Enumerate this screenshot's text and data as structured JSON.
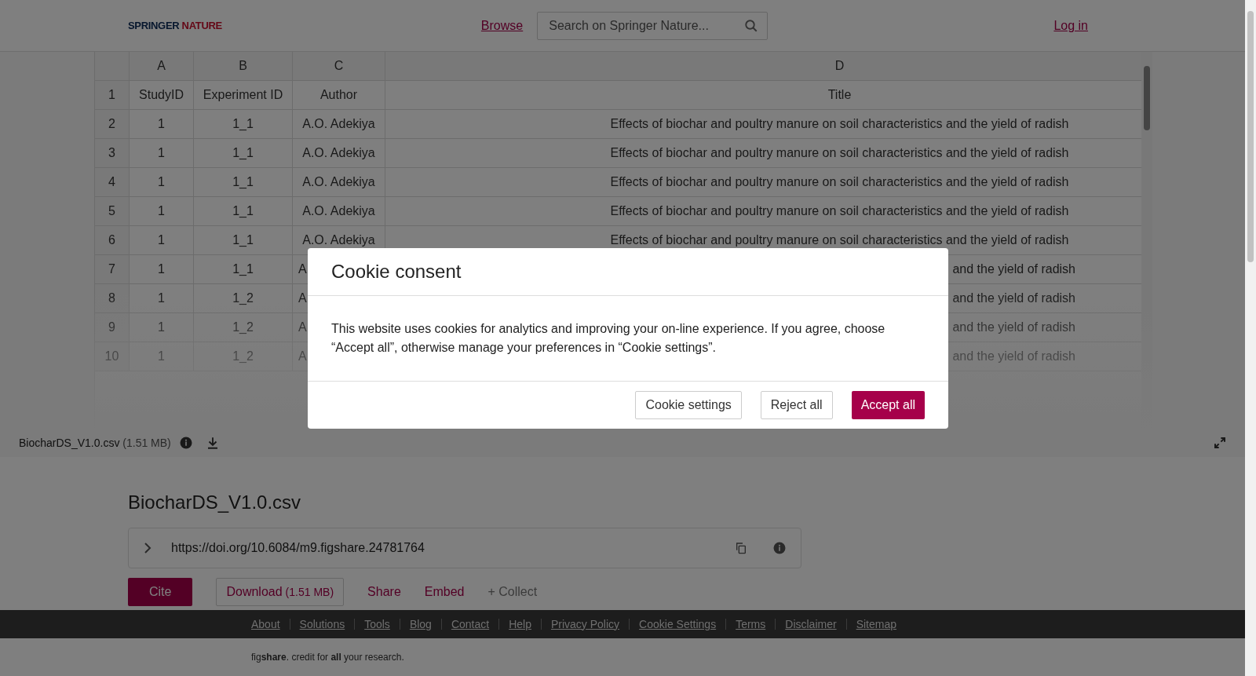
{
  "header": {
    "logo": [
      "SPRINGER",
      "NATURE"
    ],
    "browse": "Browse",
    "search": {
      "placeholder": "Search on Springer Nature..."
    },
    "login": "Log in"
  },
  "table": {
    "columns": [
      "A",
      "B",
      "C",
      "D"
    ],
    "rows": [
      {
        "number": "1",
        "cells": [
          "StudyID",
          "Experiment ID",
          "Author",
          "Title"
        ]
      },
      {
        "number": "2",
        "cells": [
          "1",
          "1_1",
          "A.O. Adekiya",
          "Effects of biochar and poultry manure on soil characteristics and the yield of radish"
        ]
      },
      {
        "number": "3",
        "cells": [
          "1",
          "1_1",
          "A.O. Adekiya",
          "Effects of biochar and poultry manure on soil characteristics and the yield of radish"
        ]
      },
      {
        "number": "4",
        "cells": [
          "1",
          "1_1",
          "A.O. Adekiya",
          "Effects of biochar and poultry manure on soil characteristics and the yield of radish"
        ]
      },
      {
        "number": "5",
        "cells": [
          "1",
          "1_1",
          "A.O. Adekiya",
          "Effects of biochar and poultry manure on soil characteristics and the yield of radish"
        ]
      },
      {
        "number": "6",
        "cells": [
          "1",
          "1_1",
          "A.O. Adekiya",
          "Effects of biochar and poultry manure on soil characteristics and the yield of radish"
        ]
      },
      {
        "number": "7",
        "covered": true,
        "cells": [
          "1",
          "1_1",
          "A",
          "and the yield of radish"
        ]
      },
      {
        "number": "8",
        "covered": true,
        "cells": [
          "1",
          "1_2",
          "A",
          "and the yield of radish"
        ]
      },
      {
        "number": "9",
        "covered": true,
        "cells": [
          "1",
          "1_2",
          "A",
          "and the yield of radish"
        ]
      },
      {
        "number": "10",
        "covered": true,
        "cells": [
          "1",
          "1_2",
          "A",
          "and the yield of radish"
        ]
      }
    ]
  },
  "file_bar": {
    "name": "BiocharDS_V1.0.csv",
    "size": "(1.51 MB)"
  },
  "item": {
    "title": "BiocharDS_V1.0.csv",
    "doi": "https://doi.org/10.6084/m9.figshare.24781764",
    "actions": [
      {
        "kind": "primary",
        "label": "Cite"
      },
      {
        "kind": "outline",
        "label": "Download",
        "size": "(1.51 MB)"
      },
      {
        "kind": "link",
        "label": "Share"
      },
      {
        "kind": "link",
        "label": "Embed"
      },
      {
        "kind": "muted",
        "label": "+ Collect"
      }
    ]
  },
  "footer": {
    "links": [
      "About",
      "Solutions",
      "Tools",
      "Blog",
      "Contact",
      "Help",
      "Privacy Policy",
      "Cookie Settings",
      "Terms",
      "Disclaimer",
      "Sitemap"
    ],
    "tagline": "fig**share**. credit for **all** your research."
  },
  "cookie_dialog": {
    "title": "Cookie consent",
    "text": "This website uses cookies for analytics and improving your on-line experience. If you agree, choose “Accept all”, otherwise manage your preferences in “Cookie settings”.",
    "buttons": [
      {
        "kind": "outline",
        "label": "Cookie settings"
      },
      {
        "kind": "outline",
        "label": "Reject all"
      },
      {
        "kind": "primary",
        "label": "Accept all"
      }
    ]
  }
}
